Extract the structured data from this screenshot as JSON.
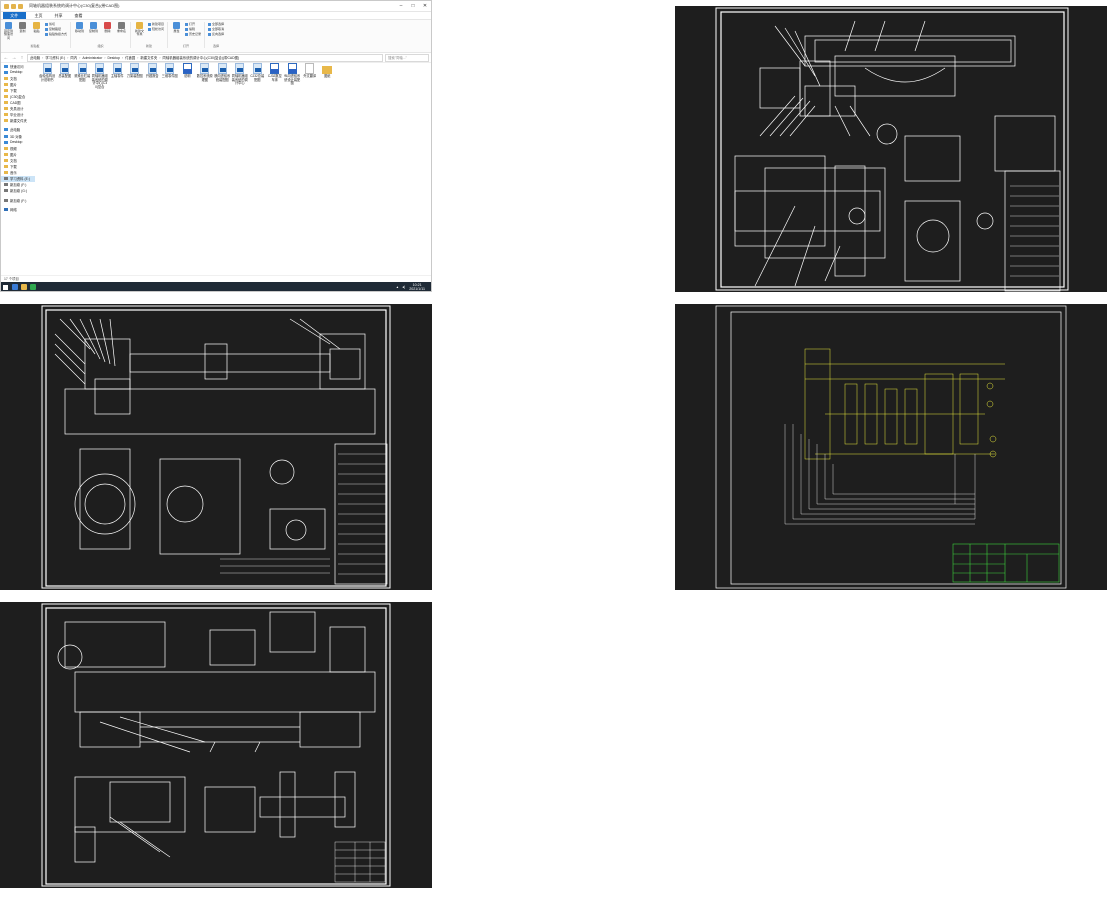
{
  "explorer": {
    "title": "同轴机器组装系统的调计中心(C30)复合)(带CAD图)",
    "ribbon_tabs": [
      "文件",
      "主页",
      "共享",
      "查看"
    ],
    "ribbon_groups": [
      {
        "name": "剪贴板",
        "commands": [
          "固定到快速访问",
          "复制",
          "粘贴"
        ],
        "minis": [
          "剪切",
          "复制路径",
          "粘贴快捷方式"
        ]
      },
      {
        "name": "组织",
        "commands": [
          "移动到",
          "复制到",
          "删除",
          "重命名"
        ],
        "minis": []
      },
      {
        "name": "新建",
        "commands": [
          "新建文件夹"
        ],
        "minis": [
          "新建项目",
          "轻松访问"
        ]
      },
      {
        "name": "打开",
        "commands": [
          "属性"
        ],
        "minis": [
          "打开",
          "编辑",
          "历史记录"
        ]
      },
      {
        "name": "选择",
        "commands": [],
        "minis": [
          "全部选择",
          "全部取消",
          "反向选择"
        ]
      }
    ],
    "address": [
      "此电脑",
      "学习资料 (E:)",
      "同内",
      "Administrator",
      "Desktop",
      "付鑫园",
      "新建文件夹",
      "同轴机器组装系统的调计中心(C30)复合)(带CAD图)"
    ],
    "search_placeholder": "搜索\"同轴...\"",
    "nav": [
      {
        "label": "快速访问",
        "kind": "pc"
      },
      {
        "label": "Desktop",
        "kind": "pc"
      },
      {
        "label": "文档",
        "kind": "folder"
      },
      {
        "label": "图片",
        "kind": "folder"
      },
      {
        "label": "下载",
        "kind": "folder"
      },
      {
        "label": "(C30)复合",
        "kind": "folder"
      },
      {
        "label": "CAD图",
        "kind": "folder"
      },
      {
        "label": "夹具设计",
        "kind": "folder"
      },
      {
        "label": "毕业设计",
        "kind": "folder"
      },
      {
        "label": "新建文件夹",
        "kind": "folder"
      },
      {
        "label": "",
        "kind": "gap"
      },
      {
        "label": "此电脑",
        "kind": "pc"
      },
      {
        "label": "3D 对象",
        "kind": "pc"
      },
      {
        "label": "Desktop",
        "kind": "pc"
      },
      {
        "label": "视频",
        "kind": "folder"
      },
      {
        "label": "图片",
        "kind": "folder"
      },
      {
        "label": "文档",
        "kind": "folder"
      },
      {
        "label": "下载",
        "kind": "folder"
      },
      {
        "label": "音乐",
        "kind": "folder"
      },
      {
        "label": "学习资料 (E:)",
        "kind": "drv",
        "selected": true
      },
      {
        "label": "新加卷 (F:)",
        "kind": "drv"
      },
      {
        "label": "新加卷 (G:)",
        "kind": "drv"
      },
      {
        "label": "",
        "kind": "gap"
      },
      {
        "label": "新加卷 (F:)",
        "kind": "drv"
      },
      {
        "label": "",
        "kind": "gap"
      },
      {
        "label": "网络",
        "kind": "net"
      }
    ],
    "files": [
      {
        "name": "齿轮结构设计说明书",
        "type": "dwg"
      },
      {
        "name": "总装配图",
        "type": "dwg"
      },
      {
        "name": "滚珠丝杠装配图",
        "type": "dwg"
      },
      {
        "name": "同轴机器组装系统的调计中心(C30)复合",
        "type": "dwg"
      },
      {
        "name": "主轴零件",
        "type": "dwg"
      },
      {
        "name": "刀架装配图",
        "type": "dwg"
      },
      {
        "name": "开题报告",
        "type": "dwg"
      },
      {
        "name": "三维零件图",
        "type": "dwg"
      },
      {
        "name": "说明",
        "type": "doc"
      },
      {
        "name": "数控系统原理图",
        "type": "dwg"
      },
      {
        "name": "横向进给系统装配图",
        "type": "dwg"
      },
      {
        "name": "同轴机器组装系统的调计中心",
        "type": "dwg"
      },
      {
        "name": "CJ32总装配图",
        "type": "dwg"
      },
      {
        "name": "CJ32数控车床",
        "type": "doc"
      },
      {
        "name": "纵向进给系统设计装配图",
        "type": "doc"
      },
      {
        "name": "外文翻译",
        "type": "txt"
      },
      {
        "name": "图纸",
        "type": "folder"
      }
    ],
    "status": "17 个项目",
    "clock_time": "10:21",
    "clock_date": "2021/1/11"
  },
  "colors": {
    "cad_background": "#1e1e1e",
    "cad_lines": "#ffffff",
    "cad_schematic": "#e8e83a",
    "cad_titleblock": "#3cd43c",
    "ribbon_file": "#1a6fc9",
    "taskbar": "#1f2a36"
  }
}
